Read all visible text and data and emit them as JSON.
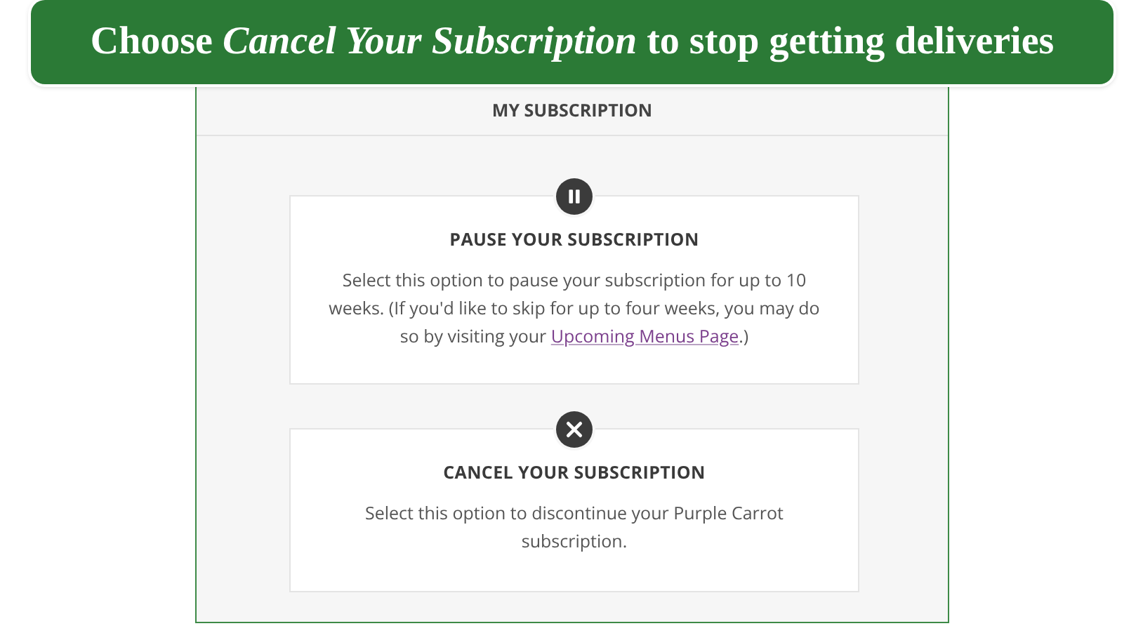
{
  "banner": {
    "caption": "Choose *Cancel Your Subscription* to stop getting deliveries"
  },
  "panel": {
    "title": "MY SUBSCRIPTION",
    "options": [
      {
        "kind": "pause",
        "title": "PAUSE YOUR SUBSCRIPTION",
        "text": "Select this option to pause your subscription for up to 10 weeks. (If you'd like to skip for up to four weeks, you may do so by visiting your ",
        "link": "Upcoming Menus Page",
        "text_after": ".)"
      },
      {
        "kind": "cancel",
        "title": "CANCEL YOUR SUBSCRIPTION",
        "text": "Select this option to discontinue your Purple Carrot subscription."
      }
    ]
  }
}
